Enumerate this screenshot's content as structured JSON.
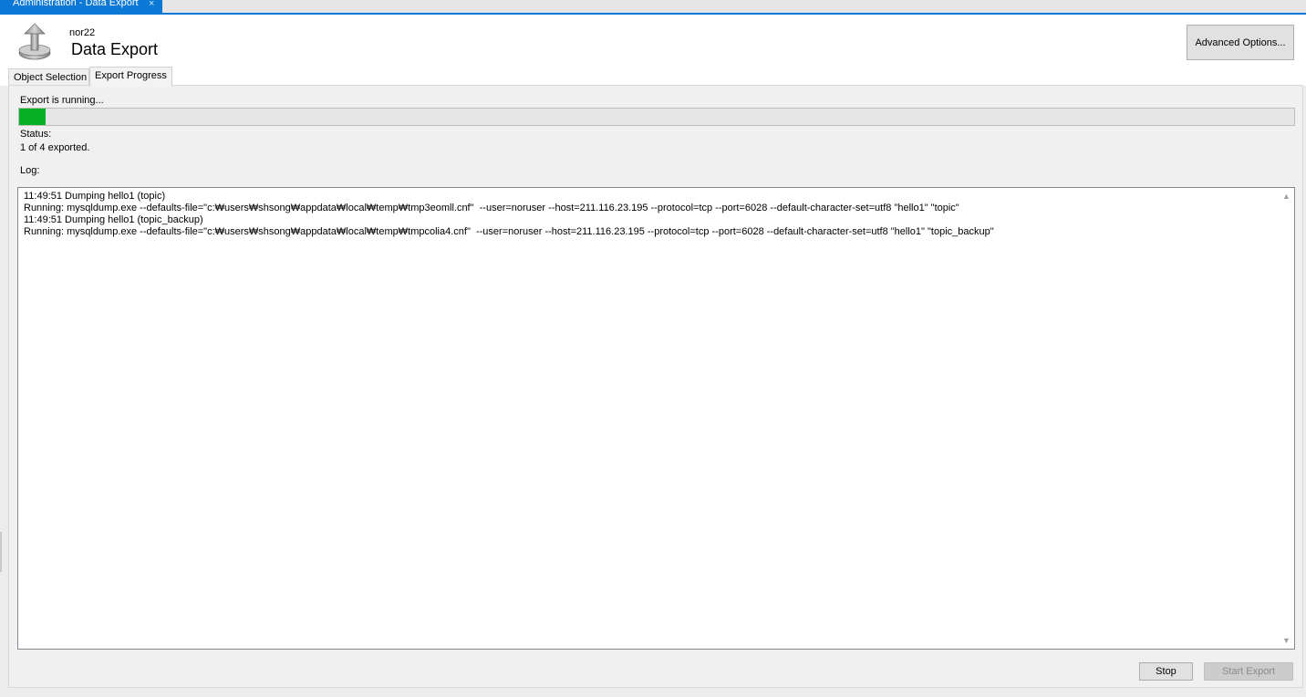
{
  "tabstrip": {
    "tab_title": "Administration - Data Export",
    "close_glyph": "×"
  },
  "header": {
    "server_name": "nor22",
    "title": "Data Export",
    "advanced_button": "Advanced Options...",
    "icon": "export-arrow-icon"
  },
  "tabs": [
    {
      "label": "Object Selection",
      "active": false
    },
    {
      "label": "Export Progress",
      "active": true
    }
  ],
  "progress": {
    "running_label": "Export is running...",
    "fraction": 0.021,
    "bar_color": "#06b025",
    "status_label": "Status:",
    "status_value": "1 of 4 exported.",
    "log_label": "Log:"
  },
  "log": {
    "lines": [
      "11:49:51 Dumping hello1 (topic)",
      "Running: mysqldump.exe --defaults-file=\"c:₩users₩shsong₩appdata₩local₩temp₩tmp3eomll.cnf\"  --user=noruser --host=211.116.23.195 --protocol=tcp --port=6028 --default-character-set=utf8 \"hello1\" \"topic\"",
      "11:49:51 Dumping hello1 (topic_backup)",
      "Running: mysqldump.exe --defaults-file=\"c:₩users₩shsong₩appdata₩local₩temp₩tmpcolia4.cnf\"  --user=noruser --host=211.116.23.195 --protocol=tcp --port=6028 --default-character-set=utf8 \"hello1\" \"topic_backup\""
    ]
  },
  "buttons": {
    "stop": "Stop",
    "start_export": "Start Export"
  },
  "colors": {
    "accent": "#0a78d4",
    "progress": "#06b025"
  }
}
